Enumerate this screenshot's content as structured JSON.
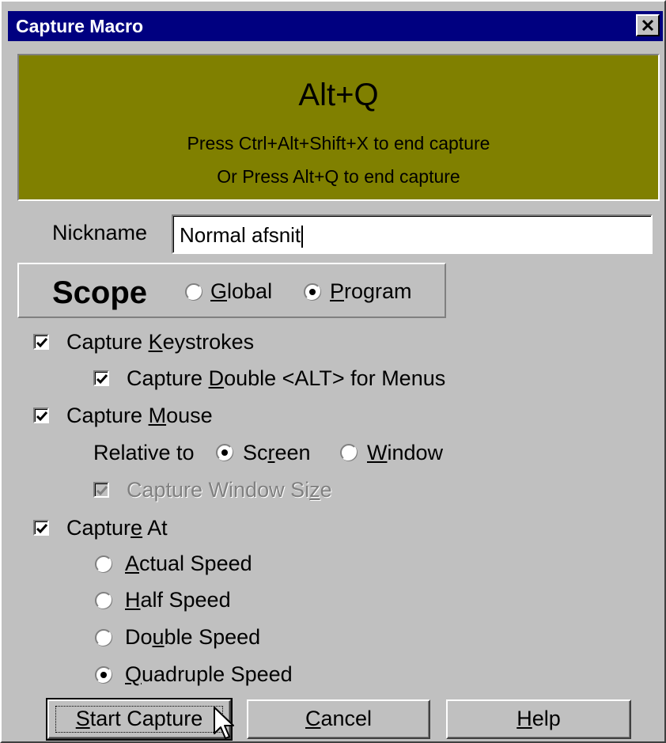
{
  "window": {
    "title": "Capture Macro"
  },
  "banner": {
    "hotkey": "Alt+Q",
    "message_1": "Press Ctrl+Alt+Shift+X to end capture",
    "message_2": "Or Press Alt+Q to end capture",
    "color": "#808000"
  },
  "nickname": {
    "label": "Nickname",
    "value": "Normal afsnit"
  },
  "scope": {
    "title": "Scope",
    "options": [
      {
        "key": "G",
        "rest": "lobal",
        "selected": false
      },
      {
        "key": "P",
        "rest": "rogram",
        "selected": true
      }
    ]
  },
  "capture_keystrokes": {
    "pre": "Capture ",
    "key": "K",
    "post": "eystrokes",
    "checked": true
  },
  "capture_double_alt": {
    "pre": "Capture ",
    "key": "D",
    "post": "ouble <ALT> for Menus",
    "checked": true
  },
  "capture_mouse": {
    "pre": "Capture ",
    "key": "M",
    "post": "ouse",
    "checked": true
  },
  "relative_to": {
    "label": "Relative to",
    "screen": {
      "pre": "Sc",
      "key": "r",
      "post": "een",
      "selected": true
    },
    "window": {
      "pre": "",
      "key": "W",
      "post": "indow",
      "selected": false
    }
  },
  "capture_window_size": {
    "pre": "Capture Window Si",
    "key": "z",
    "post": "e",
    "checked": true,
    "disabled": true
  },
  "capture_at": {
    "pre": "Captur",
    "key": "e",
    "post": " At",
    "checked": true
  },
  "speeds": [
    {
      "pre": "",
      "key": "A",
      "post": "ctual Speed",
      "selected": false
    },
    {
      "pre": "",
      "key": "H",
      "post": "alf Speed",
      "selected": false
    },
    {
      "pre": "Do",
      "key": "u",
      "post": "ble Speed",
      "selected": false
    },
    {
      "pre": "",
      "key": "Q",
      "post": "uadruple Speed",
      "selected": true
    }
  ],
  "buttons": {
    "start": {
      "key": "S",
      "post": "tart Capture"
    },
    "cancel": {
      "key": "C",
      "post": "ancel"
    },
    "help": {
      "key": "H",
      "post": "elp"
    }
  },
  "icons": {
    "close": "close-icon",
    "cursor": "mouse-pointer-icon"
  }
}
